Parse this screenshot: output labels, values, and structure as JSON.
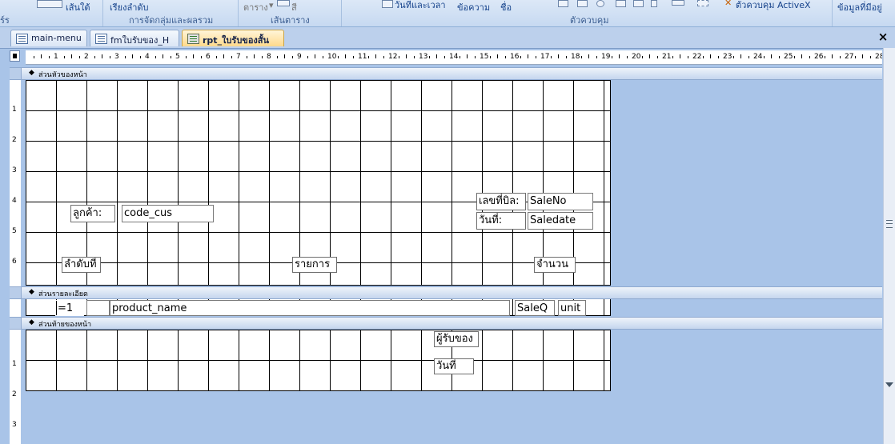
{
  "ribbon": {
    "gridlines_btn": "เส้นใต้",
    "sort_btn": "เรียงลำดับ",
    "group_caption": "การจัดกลุ่มและผลรวม",
    "table_btn": "ตาราง",
    "color_btn": "สี",
    "gridlines_caption": "เส้นตาราง",
    "datetime_btn": "วันที่และเวลา",
    "text_btn": "ข้อความ",
    "title_btn": "ชื่อ",
    "controls_caption": "ตัวควบคุม",
    "activex_btn": "ตัวควบคุม ActiveX",
    "existing_fields_btn": "ข้อมูลที่มีอยู่",
    "left_caption": "ร์ร"
  },
  "tabs": [
    {
      "label": "main-menu"
    },
    {
      "label": "fmใบรับของ_H"
    },
    {
      "label": "rpt_ใบรับของสั้น"
    }
  ],
  "close_glyph": "×",
  "ruler": {
    "numbers": [
      "1",
      "2",
      "3",
      "4",
      "5",
      "6",
      "7",
      "8",
      "9",
      "10",
      "11",
      "12",
      "13",
      "14",
      "15",
      "16",
      "17",
      "18",
      "19",
      "20",
      "21",
      "22",
      "23",
      "24",
      "25",
      "26",
      "27",
      "28"
    ],
    "vertical_header": [
      "1",
      "2",
      "3",
      "4",
      "5",
      "6"
    ],
    "vertical_footer": [
      "1",
      "2",
      "3"
    ]
  },
  "sections": {
    "page_header": "ส่วนหัวของหน้า",
    "detail": "ส่วนรายละเอียด",
    "page_footer": "ส่วนท้ายของหน้า"
  },
  "header_controls": {
    "customer_label": "ลูกค้า:",
    "customer_field": "code_cus",
    "bill_no_label": "เลขที่บิล:",
    "bill_no_field": "SaleNo",
    "date_label": "วันที่:",
    "date_field": "Saledate",
    "seq_label": "ลำดับที่",
    "item_label": "รายการ",
    "qty_label": "จำนวน"
  },
  "detail_controls": {
    "seq_field": "=1",
    "product_field": "product_name",
    "qty_field": "SaleQ",
    "unit_field": "unit"
  },
  "footer_controls": {
    "receiver_label": "ผู้รับของ",
    "date_label": "วันที่"
  }
}
